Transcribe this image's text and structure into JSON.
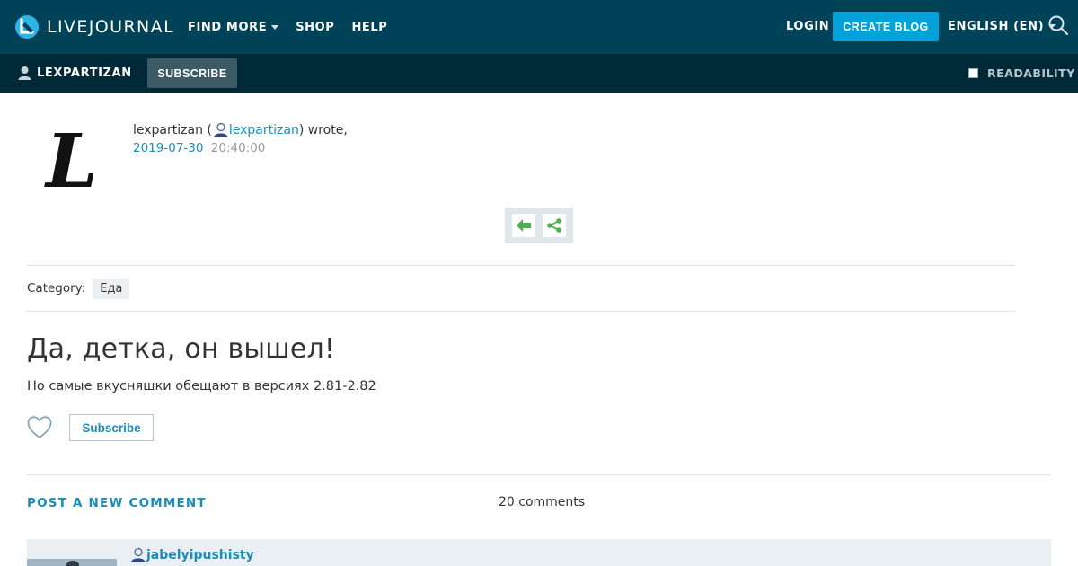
{
  "header": {
    "logo_text": "LIVEJOURNAL",
    "nav": [
      {
        "label": "FIND MORE",
        "has_dropdown": true
      },
      {
        "label": "SHOP",
        "has_dropdown": false
      },
      {
        "label": "HELP",
        "has_dropdown": false
      }
    ],
    "login_label": "LOGIN",
    "create_blog_label": "CREATE BLOG",
    "language_label": "ENGLISH (EN)"
  },
  "journal_bar": {
    "username": "LEXPARTIZAN",
    "subscribe_label": "SUBSCRIBE",
    "readability_label": "READABILITY",
    "readability_checked": false
  },
  "post": {
    "author_display": "lexpartizan",
    "author_link": "lexpartizan",
    "wrote_suffix": "wrote,",
    "date": "2019-07-30",
    "time": "20:40:00",
    "avatar_letter": "L",
    "category_label": "Category:",
    "category_tag": "Еда",
    "title": "Да, детка, он вышел!",
    "body": "Но самые вкусняшки обещают в версиях 2.81-2.82",
    "subscribe_label": "Subscribe"
  },
  "comments": {
    "post_new_label": "POST A NEW COMMENT",
    "count_label": "20 comments",
    "items": [
      {
        "author": "jabelyipushisty"
      }
    ]
  },
  "colors": {
    "topbar": "#004359",
    "subbar": "#002937",
    "accent": "#00a3d9",
    "link": "#1a8db8",
    "share_green": "#4caf50"
  }
}
